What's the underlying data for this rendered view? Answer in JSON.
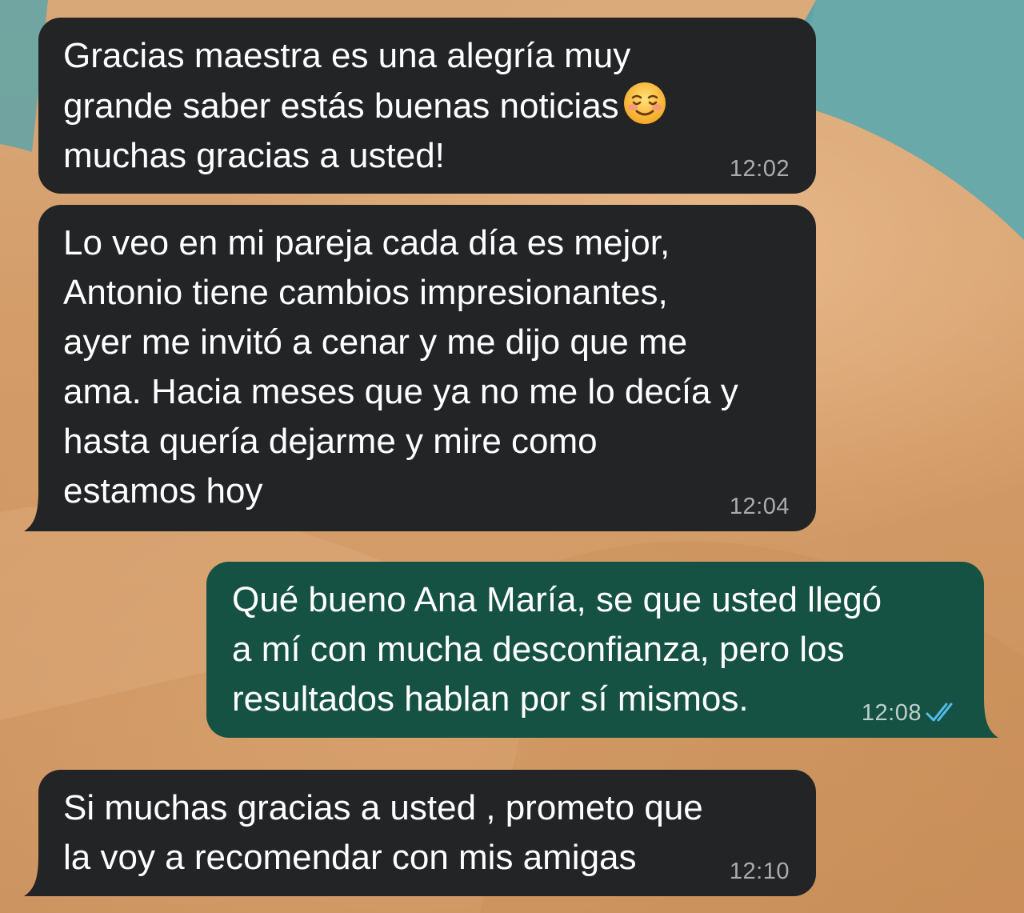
{
  "messages": [
    {
      "direction": "incoming",
      "lines": [
        "Gracias maestra es una alegría muy",
        "grande saber estás buenas noticias",
        "muchas gracias a usted!"
      ],
      "emoji": "relieved-smiling-face-emoji",
      "time": "12:02"
    },
    {
      "direction": "incoming",
      "lines": [
        "Lo veo en mi pareja cada día es mejor,",
        "Antonio tiene cambios impresionantes,",
        "ayer me invitó a cenar y me dijo que me",
        "ama. Hacia meses que ya no me lo decía y",
        "hasta quería dejarme y mire como",
        "estamos hoy"
      ],
      "time": "12:04"
    },
    {
      "direction": "outgoing",
      "lines": [
        "Qué bueno Ana María, se que usted llegó",
        "a mí con mucha desconfianza, pero los",
        "resultados hablan por sí mismos."
      ],
      "time": "12:08",
      "status_icon": "double-check-read-icon",
      "status_color": "#53bdeb"
    },
    {
      "direction": "incoming",
      "lines": [
        "Si muchas gracias a usted , prometo que",
        "la voy a recomendar con mis amigas"
      ],
      "time": "12:10"
    }
  ],
  "colors": {
    "incoming_bubble": "#232426",
    "outgoing_bubble": "#155243",
    "text": "#ffffff",
    "read_ticks": "#53bdeb"
  }
}
